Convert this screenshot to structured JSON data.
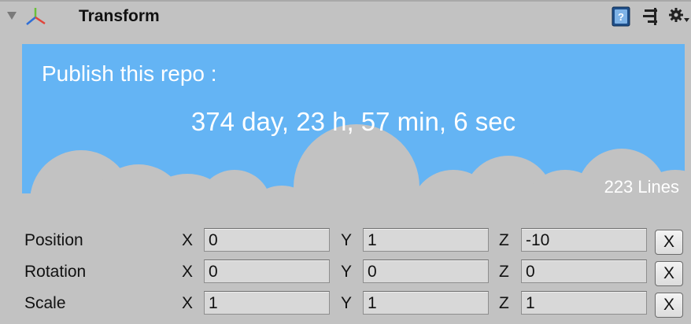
{
  "component": {
    "title": "Transform",
    "icons": {
      "foldout": "foldout-triangle-icon",
      "component": "transform-axis-icon",
      "help": "help-book-icon",
      "preset": "preset-sliders-icon",
      "settings": "gear-icon"
    }
  },
  "banner": {
    "heading": "Publish this repo :",
    "countdown": "374 day, 23 h, 57 min, 6 sec",
    "lines": "223 Lines",
    "colors": {
      "sky": "#64b4f4",
      "cloud": "#c2c2c2",
      "text": "#ffffff"
    }
  },
  "transform": {
    "rows": [
      {
        "label": "Position",
        "x": "0",
        "y": "1",
        "z": "-10",
        "reset": "X"
      },
      {
        "label": "Rotation",
        "x": "0",
        "y": "0",
        "z": "0",
        "reset": "X"
      },
      {
        "label": "Scale",
        "x": "1",
        "y": "1",
        "z": "1",
        "reset": "X"
      }
    ],
    "axis_labels": {
      "x": "X",
      "y": "Y",
      "z": "Z"
    }
  }
}
